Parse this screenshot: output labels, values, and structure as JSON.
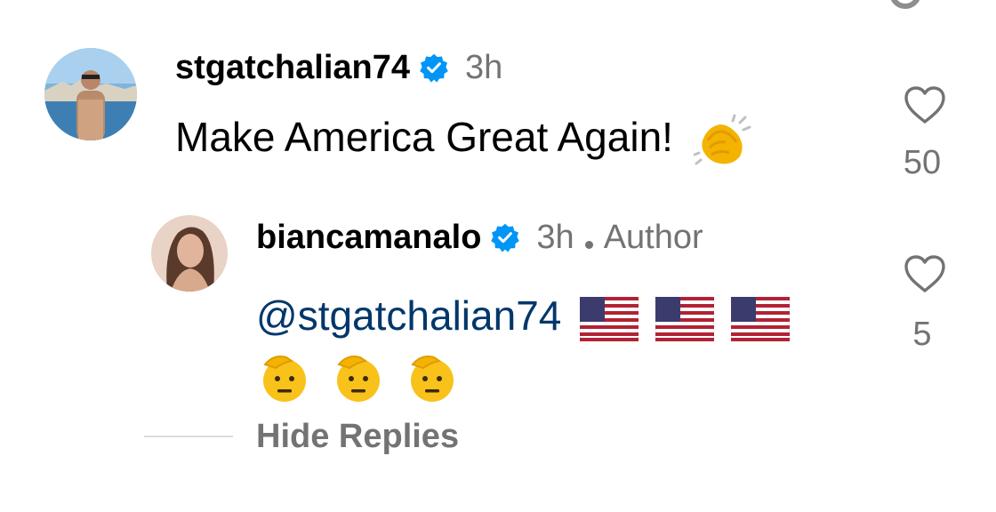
{
  "icons": {
    "verified": "verified-badge-icon",
    "like": "heart-outline-icon",
    "clap": "clapping-hands-emoji",
    "flag": "us-flag-emoji",
    "salute": "saluting-face-emoji"
  },
  "colors": {
    "verified_blue": "#0095f6",
    "muted_text": "#737373",
    "mention": "#00376b",
    "heart_stroke": "#737373"
  },
  "comment": {
    "username": "stgatchalian74",
    "time": "3h",
    "text": "Make America Great Again!",
    "like_count": "50"
  },
  "reply": {
    "username": "biancamanalo",
    "time": "3h",
    "author_label": "Author",
    "mention": "@stgatchalian74",
    "like_count": "5"
  },
  "replies": {
    "hide_label": "Hide Replies"
  }
}
